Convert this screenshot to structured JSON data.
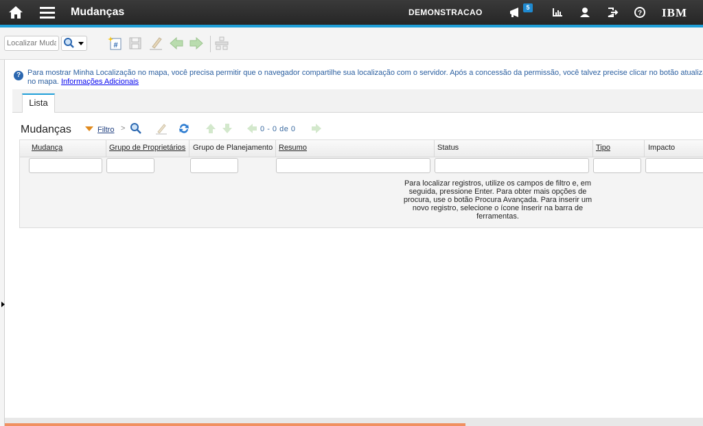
{
  "topbar": {
    "app_title": "Mudanças",
    "site_name": "DEMONSTRACAO",
    "notification_count": "5",
    "brand": "IBM",
    "icons": [
      "home-icon",
      "menu-icon",
      "bulletin-icon",
      "reports-icon",
      "profile-icon",
      "signout-icon",
      "help-icon"
    ]
  },
  "toolbar": {
    "find_placeholder": "Localizar Mudança",
    "tools": [
      "new-record-icon",
      "save-icon",
      "clear-changes-icon",
      "previous-record-icon",
      "next-record-icon",
      "workflow-icon"
    ]
  },
  "info": {
    "message_line1": "Para mostrar Minha Localização no mapa, você precisa permitir que o navegador compartilhe sua localização com o servidor. Após a concessão da permissão, você talvez precise clicar no botão atualizar",
    "message_line2": "no mapa.",
    "link": "Informações Adicionais"
  },
  "tabs": [
    {
      "label": "Lista",
      "active": true
    }
  ],
  "list": {
    "title": "Mudanças",
    "filter_label": "Filtro",
    "pager": {
      "start": "0",
      "sep": "-",
      "end": "0",
      "of_label": "de",
      "total": "0"
    },
    "columns": [
      "Mudança",
      "Grupo de Proprietários",
      "Grupo de Planejamento",
      "Resumo",
      "Status",
      "Tipo",
      "Impacto"
    ],
    "empty_message": "Para localizar registros, utilize os campos de filtro e, em seguida, pressione Enter. Para obter mais opções de procura, use o botão Procura Avançada. Para inserir um novo registro, selecione o ícone Inserir na barra de ferramentas."
  },
  "colors": {
    "accent": "#1f9fd8",
    "topbar": "#2e2e2e",
    "link": "#2b5fa0",
    "filter": "#e08a1e"
  }
}
